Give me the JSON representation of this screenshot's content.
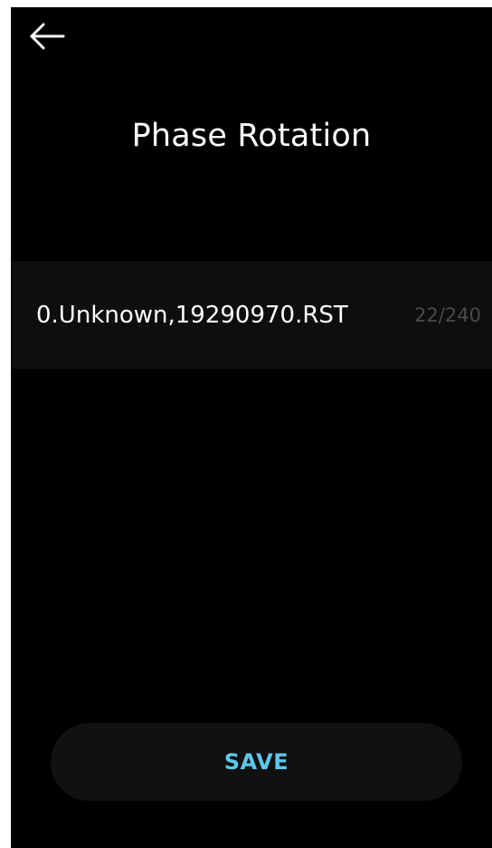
{
  "header": {
    "back_icon": "arrow-left-icon",
    "title": "Phase Rotation"
  },
  "field": {
    "value": "0.Unknown,19290970.RST",
    "counter": "22/240"
  },
  "actions": {
    "save_label": "SAVE"
  },
  "colors": {
    "background": "#000000",
    "field_background": "#0e0e0e",
    "button_background": "#111111",
    "accent": "#5cc8ee",
    "counter": "#4a4a4a"
  }
}
